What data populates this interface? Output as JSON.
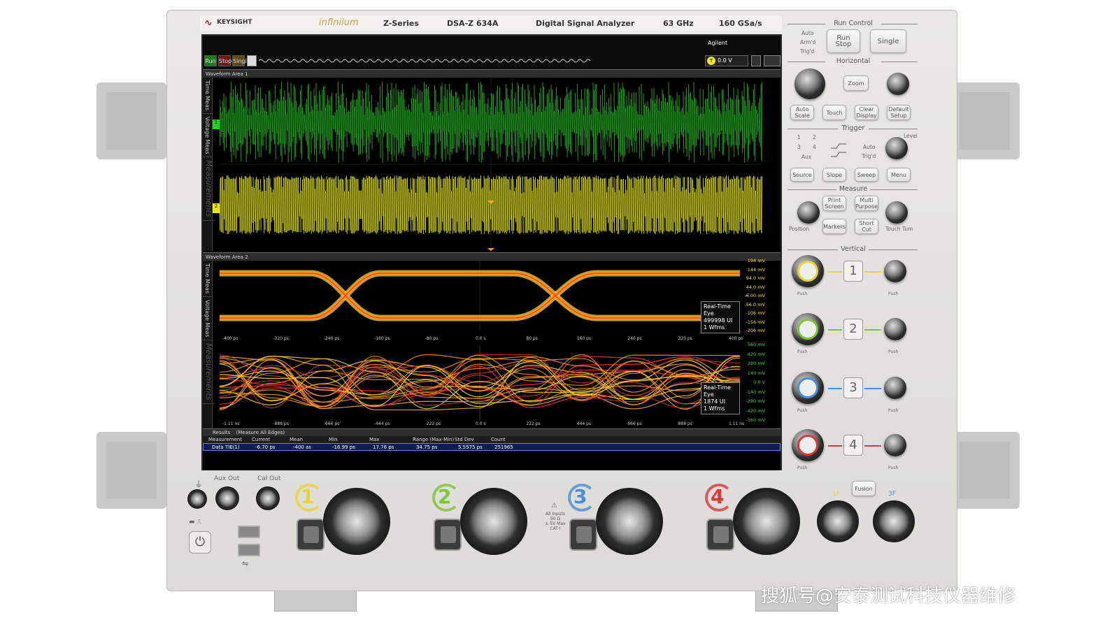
{
  "header": {
    "brand": "KEYSIGHT",
    "product_line": "infiniium",
    "series": "Z-Series",
    "model": "DSA-Z 634A",
    "description": "Digital Signal Analyzer",
    "bandwidth": "63 GHz",
    "sample_rate": "160 GSa/s"
  },
  "screen": {
    "agilent_label": "Agilent",
    "run_label": "Run",
    "stop_label": "Stop",
    "single_label": "Single",
    "trigger_level": "0.0 V",
    "trigger_badge": "T",
    "area1_title": "Waveform Area 1",
    "area2_title": "Waveform Area 2",
    "side_tabs": [
      "Time Meas",
      "Voltage Meas",
      "Measurements"
    ],
    "eye1": {
      "y_labels": [
        "194 mV",
        "144 mV",
        "94.0 mV",
        "44.0 mV",
        "-6.00 mV",
        "-56.0 mV",
        "-106 mV",
        "-156 mV",
        "-206 mV"
      ],
      "x_labels": [
        "-400 ps",
        "-320 ps",
        "-240 ps",
        "-160 ps",
        "-80 ps",
        "0.0 s",
        "80 ps",
        "160 ps",
        "240 ps",
        "320 ps",
        "400 ps"
      ],
      "box": [
        "Real-Time Eye",
        "499998 UI",
        "1 Wfms"
      ],
      "index": "1"
    },
    "eye2": {
      "y_labels": [
        "560 mV",
        "420 mV",
        "280 mV",
        "140 mV",
        "0.0 V",
        "-140 mV",
        "-280 mV",
        "-420 mV",
        "-560 mV"
      ],
      "x_labels": [
        "-1.11 ns",
        "-888 ps",
        "-666 ps",
        "-444 ps",
        "-222 ps",
        "0.0 s",
        "222 ps",
        "444 ps",
        "666 ps",
        "888 ps",
        "1.11 ns"
      ],
      "box": [
        "Real-Time Eye",
        "1874 UI",
        "1 Wfms"
      ],
      "index": "2"
    },
    "results": {
      "title": "Results",
      "mode": "(Measure All Edges)",
      "headers": [
        "Measurement",
        "Current",
        "Mean",
        "Min",
        "Max",
        "Range (Max-Min)",
        "Std Dev",
        "Count"
      ],
      "row": [
        "Data TIE(1)",
        "-6.70 ps",
        "-400 as",
        "-16.99 ps",
        "17.76 ps",
        "34.75 ps",
        "5.5575 ps",
        "251965"
      ]
    },
    "colors": {
      "ch1": "#24d024",
      "ch2": "#e6e614",
      "eye_core": "#ff3b2f",
      "eye_mid": "#ff9a1a",
      "eye_outer": "#ffe23d"
    }
  },
  "panel": {
    "run_control": "Run Control",
    "auto": "Auto",
    "armd": "Arm'd",
    "trigd": "Trig'd",
    "run_stop": [
      "Run",
      "Stop"
    ],
    "single": "Single",
    "horizontal": "Horizontal",
    "push_vernier": "Push for Vernier",
    "push_zero": "Push to Zero",
    "zoom": "Zoom",
    "auto_scale": [
      "Auto",
      "Scale"
    ],
    "touch": "Touch",
    "clear_display": [
      "Clear",
      "Display"
    ],
    "default_setup": [
      "Default",
      "Setup"
    ],
    "trigger": "Trigger",
    "trigger_sources": [
      "1",
      "2",
      "3",
      "4",
      "Aux"
    ],
    "trig_auto": "Auto",
    "trig_trigd": "Trig'd",
    "level": "Level",
    "level_hint": "(Push for 50%)",
    "source": "Source",
    "slope": "Slope",
    "sweep": "Sweep",
    "menu": "Menu",
    "measure": "Measure",
    "print_screen": [
      "Print",
      "Screen"
    ],
    "multi_purpose": [
      "Multi",
      "Purpose"
    ],
    "markers": "Markers",
    "short_cut": [
      "Short",
      "Cut"
    ],
    "position": "Position",
    "position_hint": "(Push to Toggle)",
    "markers_hint": "(Hold to Reset)",
    "touch_turn": "Touch Turn",
    "vertical": "Vertical",
    "push": "Push",
    "for_vernier": "for Vernier",
    "to_zero": "to Zero",
    "channels": [
      "1",
      "2",
      "3",
      "4"
    ],
    "channel_colors": [
      "#e8d23a",
      "#7fc43a",
      "#4b8fd6",
      "#d83a3a"
    ]
  },
  "front": {
    "ground_symbol": "⏚",
    "aux_out": "Aux Out",
    "cal_out": "Cal Out",
    "all_inputs": [
      "All Inputs",
      "50 Ω",
      "± 5V Max",
      "CAT I"
    ],
    "fusion": "Fusion",
    "label_3f": "3F",
    "label_1f": "1F",
    "usb_symbol": "⭠",
    "power_symbol": "⏻"
  },
  "watermark": "搜狐号@安泰测试科技仪器维修"
}
